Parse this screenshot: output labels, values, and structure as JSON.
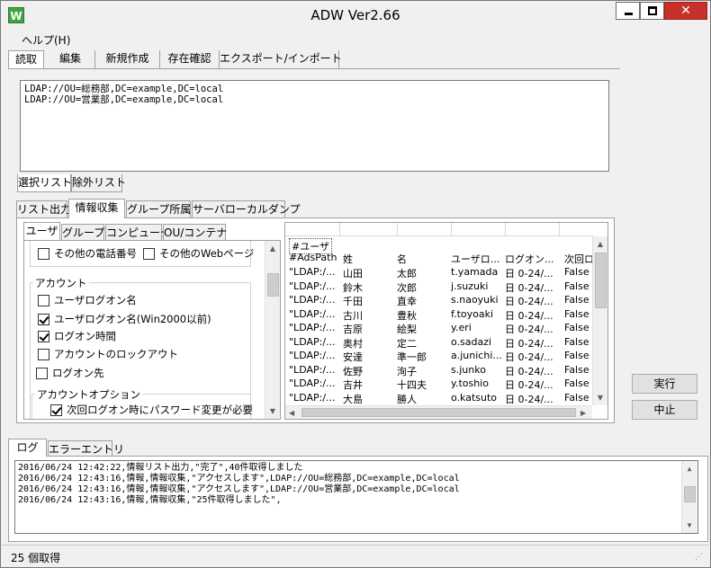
{
  "window": {
    "title": "ADW Ver2.66",
    "app_icon": "W"
  },
  "menu": {
    "help": "ヘルプ(H)"
  },
  "main_tabs": [
    "読取",
    "編集",
    "新規作成",
    "存在確認",
    "エクスポート/インポート"
  ],
  "ldap_list": [
    "LDAP://OU=総務部,DC=example,DC=local",
    "LDAP://OU=営業部,DC=example,DC=local"
  ],
  "list_tabs": [
    "選択リスト",
    "除外リスト"
  ],
  "mode_tabs": [
    "リスト出力",
    "情報収集",
    "グループ所属",
    "サーバローカルダンプ"
  ],
  "object_tabs": [
    "ユーザ",
    "グループ",
    "コンピュータ",
    "OU/コンテナ"
  ],
  "options": {
    "other_phone": "その他の電話番号",
    "other_web": "その他のWebページ",
    "account_group": "アカウント",
    "logon_name": "ユーザログオン名",
    "logon_name_pre2000": "ユーザログオン名(Win2000以前)",
    "logon_hours": "ログオン時間",
    "lockout": "アカウントのロックアウト",
    "logon_to": "ログオン先",
    "account_options_group": "アカウントオプション",
    "must_change_pwd": "次回ログオン時にパスワード変更が必要"
  },
  "grid": {
    "section": "#ユーザ",
    "headers": [
      "#AdsPath",
      "姓",
      "名",
      "ユーザロ...",
      "ログオン...",
      "次回ロ"
    ],
    "rows": [
      [
        "\"LDAP:/...",
        "山田",
        "太郎",
        "t.yamada",
        "日 0-24/...",
        "False"
      ],
      [
        "\"LDAP:/...",
        "鈴木",
        "次郎",
        "j.suzuki",
        "日 0-24/...",
        "False"
      ],
      [
        "\"LDAP:/...",
        "千田",
        "直幸",
        "s.naoyuki",
        "日 0-24/...",
        "False"
      ],
      [
        "\"LDAP:/...",
        "古川",
        "豊秋",
        "f.toyoaki",
        "日 0-24/...",
        "False"
      ],
      [
        "\"LDAP:/...",
        "吉原",
        "絵梨",
        "y.eri",
        "日 0-24/...",
        "False"
      ],
      [
        "\"LDAP:/...",
        "奥村",
        "定二",
        "o.sadazi",
        "日 0-24/...",
        "False"
      ],
      [
        "\"LDAP:/...",
        "安達",
        "準一郎",
        "a.junichi...",
        "日 0-24/...",
        "False"
      ],
      [
        "\"LDAP:/...",
        "佐野",
        "洵子",
        "s.junko",
        "日 0-24/...",
        "False"
      ],
      [
        "\"LDAP:/...",
        "吉井",
        "十四夫",
        "y.toshio",
        "日 0-24/...",
        "False"
      ],
      [
        "\"LDAP:/...",
        "大島",
        "勝人",
        "o.katsuto",
        "日 0-24/...",
        "False"
      ]
    ]
  },
  "buttons": {
    "run": "実行",
    "stop": "中止"
  },
  "log_tabs": [
    "ログ",
    "エラーエントリ"
  ],
  "log_lines": [
    "2016/06/24 12:42:22,情報リスト出力,\"完了\",40件取得しました",
    "2016/06/24 12:43:16,情報,情報収集,\"アクセスします\",LDAP://OU=総務部,DC=example,DC=local",
    "2016/06/24 12:43:16,情報,情報収集,\"アクセスします\",LDAP://OU=営業部,DC=example,DC=local",
    "2016/06/24 12:43:16,情報,情報収集,\"25件取得しました\","
  ],
  "status": "25 個取得",
  "colors": {
    "close_button": "#c7312b",
    "app_icon": "#3fa53f"
  }
}
